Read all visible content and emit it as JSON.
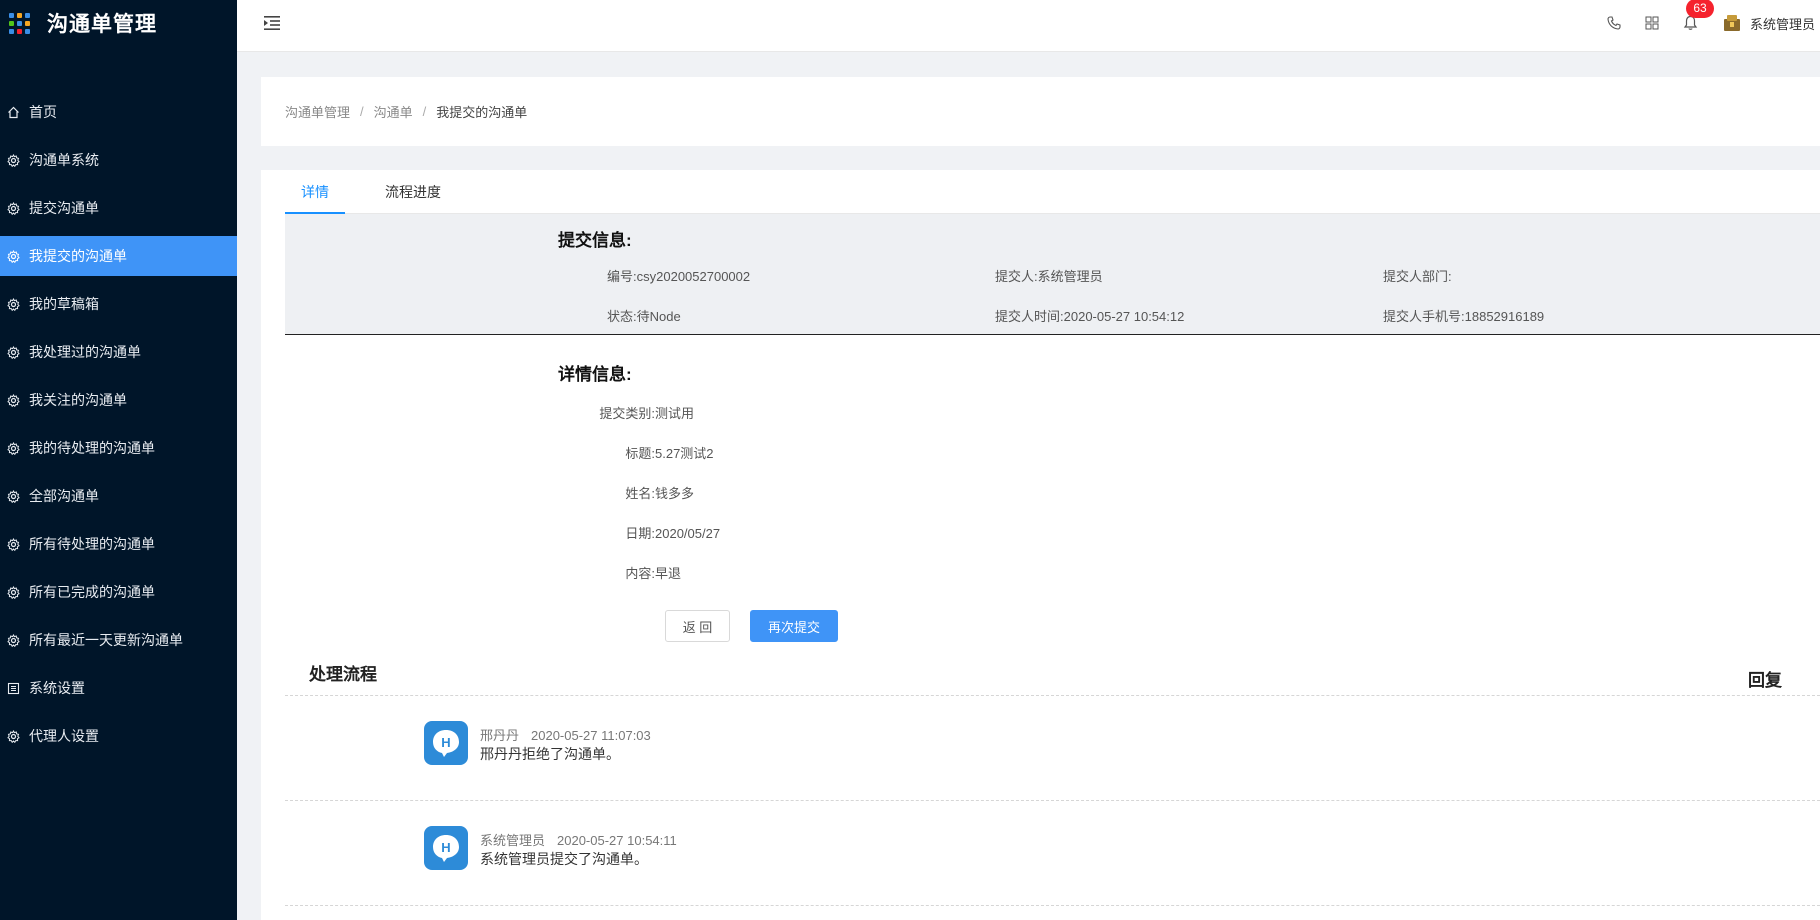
{
  "app": {
    "title": "沟通单管理"
  },
  "sidebar": {
    "items": [
      {
        "label": "首页",
        "icon": "home-icon",
        "active": false
      },
      {
        "label": "沟通单系统",
        "icon": "gear-icon",
        "active": false
      },
      {
        "label": "提交沟通单",
        "icon": "gear-icon",
        "active": false
      },
      {
        "label": "我提交的沟通单",
        "icon": "gear-icon",
        "active": true
      },
      {
        "label": "我的草稿箱",
        "icon": "gear-icon",
        "active": false
      },
      {
        "label": "我处理过的沟通单",
        "icon": "gear-icon",
        "active": false
      },
      {
        "label": "我关注的沟通单",
        "icon": "gear-icon",
        "active": false
      },
      {
        "label": "我的待处理的沟通单",
        "icon": "gear-icon",
        "active": false
      },
      {
        "label": "全部沟通单",
        "icon": "gear-icon",
        "active": false
      },
      {
        "label": "所有待处理的沟通单",
        "icon": "gear-icon",
        "active": false
      },
      {
        "label": "所有已完成的沟通单",
        "icon": "gear-icon",
        "active": false
      },
      {
        "label": "所有最近一天更新沟通单",
        "icon": "gear-icon",
        "active": false
      },
      {
        "label": "系统设置",
        "icon": "list-icon",
        "active": false
      },
      {
        "label": "代理人设置",
        "icon": "gear-icon",
        "active": false
      }
    ]
  },
  "header": {
    "notification_count": "63",
    "username": "系统管理员"
  },
  "breadcrumb": {
    "items": [
      "沟通单管理",
      "沟通单",
      "我提交的沟通单"
    ]
  },
  "tabs": [
    {
      "label": "详情",
      "active": true
    },
    {
      "label": "流程进度",
      "active": false
    }
  ],
  "submit_info": {
    "title": "提交信息:",
    "number_label": "编号:",
    "number": "csy2020052700002",
    "submitter_label": "提交人:",
    "submitter": "系统管理员",
    "dept_label": "提交人部门:",
    "dept": "",
    "status_label": "状态:",
    "status": "待Node",
    "time_label": "提交人时间:",
    "time": "2020-05-27 10:54:12",
    "phone_label": "提交人手机号:",
    "phone": "18852916189"
  },
  "detail_info": {
    "title": "详情信息:",
    "category_label": "提交类别:",
    "category": "测试用",
    "subject_label": "标题:",
    "subject": "5.27测试2",
    "name_label": "姓名:",
    "name": "钱多多",
    "date_label": "日期:",
    "date": "2020/05/27",
    "content_label": "内容:",
    "content": "早退"
  },
  "actions": {
    "back_label": "返 回",
    "resubmit_label": "再次提交"
  },
  "flow": {
    "title": "处理流程",
    "reply_title": "回复",
    "entries": [
      {
        "name": "邢丹丹",
        "time": "2020-05-27 11:07:03",
        "text": "邢丹丹拒绝了沟通单。"
      },
      {
        "name": "系统管理员",
        "time": "2020-05-27 10:54:11",
        "text": "系统管理员提交了沟通单。"
      }
    ]
  },
  "colors": {
    "sidebar_bg": "#001529",
    "accent": "#3f94f7",
    "badge": "#f5222d"
  }
}
